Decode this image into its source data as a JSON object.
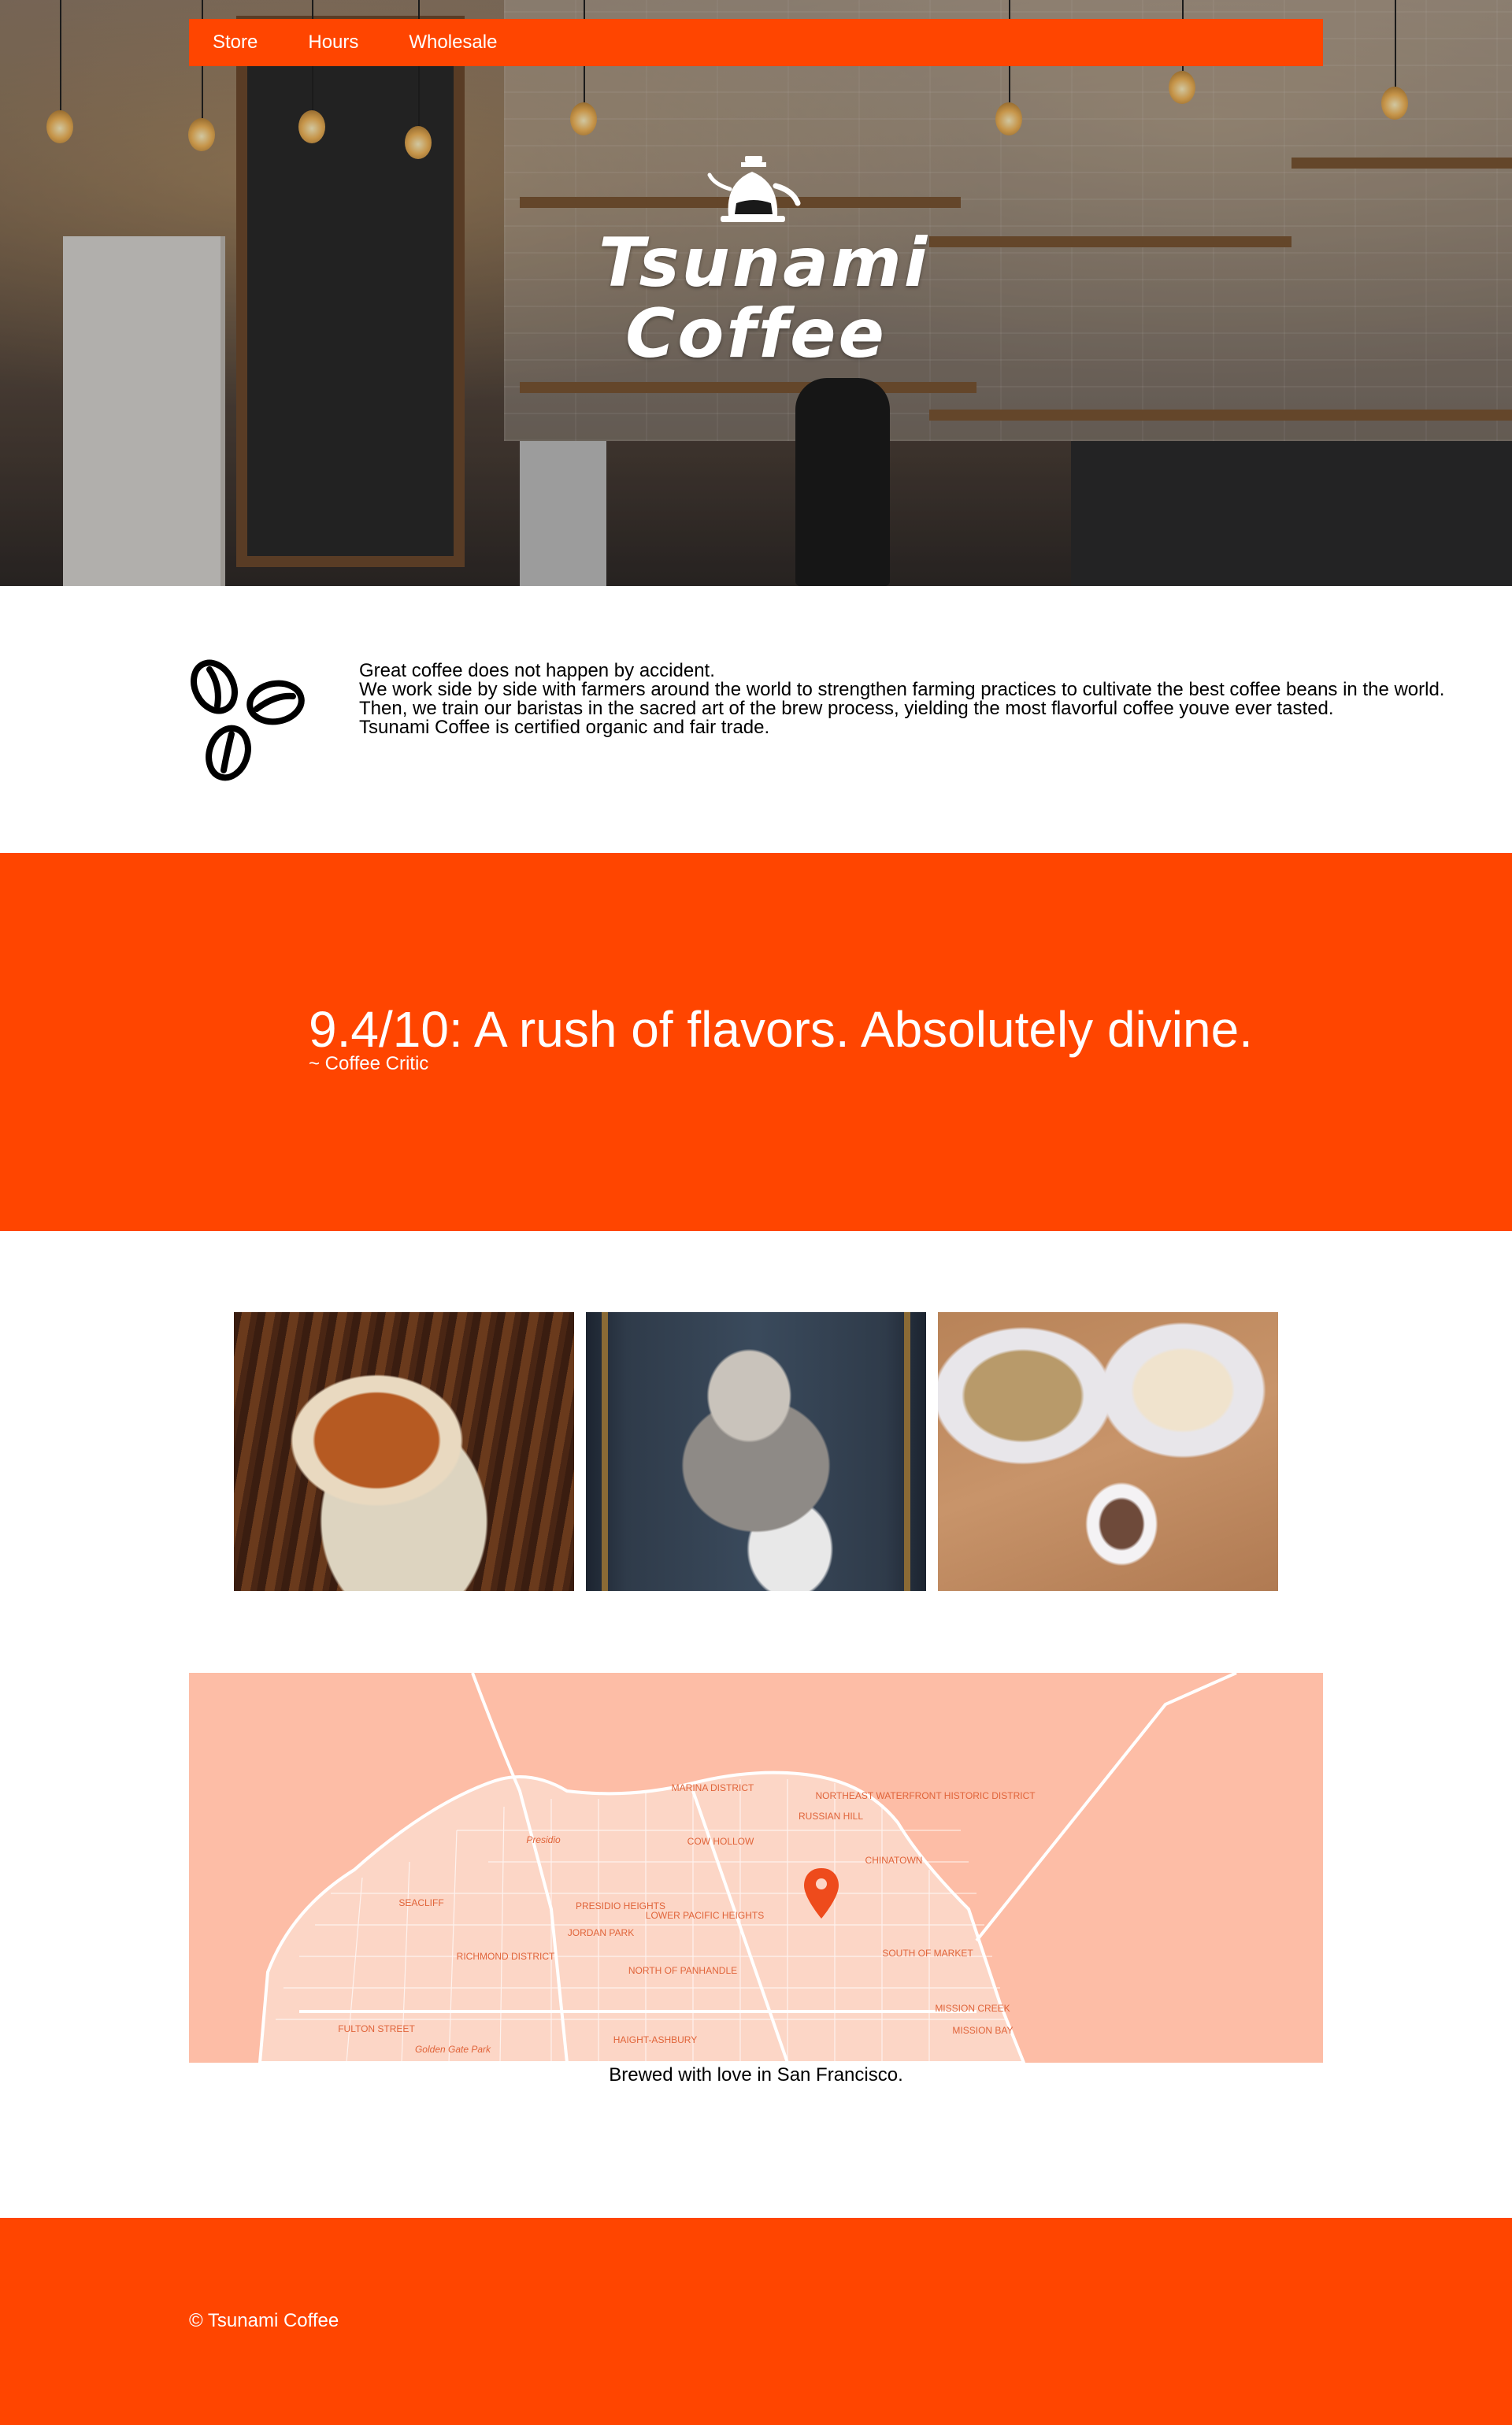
{
  "brand": {
    "name": "Tsunami Coffee",
    "logo_line_1": "Tsunami",
    "logo_line_2": "Coffee",
    "accent_color": "#ff4500"
  },
  "nav": {
    "items": [
      {
        "label": "Store"
      },
      {
        "label": "Hours"
      },
      {
        "label": "Wholesale"
      }
    ]
  },
  "about": {
    "icon": "coffee-beans-icon",
    "lines": [
      "Great coffee does not happen by accident.",
      "We work side by side with farmers around the world to strengthen farming practices to cultivate the best coffee beans in the world. Then, we train our baristas in the sacred art of the brew process, yielding the most flavorful coffee youve ever tasted.",
      "Tsunami Coffee is certified organic and fair trade."
    ]
  },
  "quote": {
    "text": "9.4/10: A rush of flavors. Absolutely divine.",
    "attribution": "~ Coffee Critic"
  },
  "gallery": {
    "photos": [
      "latte-art-cup-photo",
      "bearded-man-with-mug-photo",
      "breakfast-plates-photo"
    ]
  },
  "map": {
    "labels": [
      "MARINA DISTRICT",
      "RUSSIAN HILL",
      "NORTHEAST WATERFRONT HISTORIC DISTRICT",
      "Presidio",
      "COW HOLLOW",
      "CHINATOWN",
      "SEACLIFF",
      "PRESIDIO HEIGHTS",
      "LOWER PACIFIC HEIGHTS",
      "JORDAN PARK",
      "RICHMOND DISTRICT",
      "NORTH OF PANHANDLE",
      "SOUTH OF MARKET",
      "MISSION CREEK",
      "MISSION BAY",
      "FULTON STREET",
      "HAIGHT-ASHBURY",
      "Golden Gate Park"
    ],
    "marker_icon": "map-pin-icon",
    "caption": "Brewed with love in San Francisco."
  },
  "footer": {
    "copyright": "© Tsunami Coffee"
  }
}
